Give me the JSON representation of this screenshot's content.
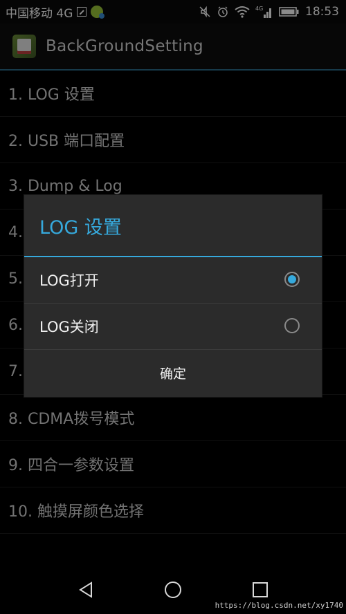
{
  "status_bar": {
    "carrier": "中国移动 4G",
    "time": "18:53",
    "network_badge": "4G"
  },
  "app_bar": {
    "title": "BackGroundSetting"
  },
  "menu": {
    "items": [
      {
        "label": "1. LOG 设置"
      },
      {
        "label": "2. USB 端口配置"
      },
      {
        "label": "3. Dump & Log"
      },
      {
        "label": "4."
      },
      {
        "label": "5."
      },
      {
        "label": "6."
      },
      {
        "label": "7."
      },
      {
        "label": "8. CDMA拨号模式"
      },
      {
        "label": "9. 四合一参数设置"
      },
      {
        "label": "10. 触摸屏颜色选择"
      }
    ]
  },
  "dialog": {
    "title": "LOG 设置",
    "options": [
      {
        "label": "LOG打开",
        "checked": true
      },
      {
        "label": "LOG关闭",
        "checked": false
      }
    ],
    "confirm_label": "确定"
  },
  "watermark": "https://blog.csdn.net/xy1740",
  "colors": {
    "accent": "#36a9dc",
    "dialog_bg": "#2b2b2b",
    "screen_bg": "#000000"
  }
}
